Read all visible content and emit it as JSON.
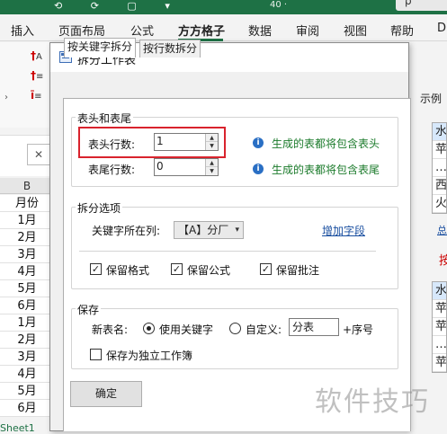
{
  "excel": {
    "title_text": "40 ·",
    "search_label": "ρ",
    "menu": [
      {
        "label": "插入"
      },
      {
        "label": "页面布局"
      },
      {
        "label": "公式"
      },
      {
        "label": "方方格子"
      },
      {
        "label": "数据"
      },
      {
        "label": "审阅"
      },
      {
        "label": "视图"
      },
      {
        "label": "帮助"
      },
      {
        "label": "D"
      }
    ],
    "column_header": "B",
    "cells": [
      "月份",
      "1月",
      "2月",
      "3月",
      "4月",
      "5月",
      "6月",
      "1月",
      "2月",
      "3月",
      "4月",
      "5月",
      "6月"
    ],
    "sheet_tab": "Sheet1",
    "formula_cancel": "✕"
  },
  "dialog": {
    "title": "拆分工作表",
    "tabs": [
      {
        "label": "按关键字拆分",
        "active": true
      },
      {
        "label": "按行数拆分",
        "active": false
      }
    ],
    "header_footer": {
      "group_label": "表头和表尾",
      "header_rows_label": "表头行数:",
      "header_rows_value": "1",
      "footer_rows_label": "表尾行数:",
      "footer_rows_value": "0",
      "header_hint": "生成的表都将包含表头",
      "footer_hint": "生成的表都将包含表尾"
    },
    "split_options": {
      "group_label": "拆分选项",
      "key_column_label": "关键字所在列:",
      "key_column_value": "【A】分厂",
      "add_field_link": "增加字段",
      "checkboxes": [
        {
          "label": "保留格式",
          "checked": true
        },
        {
          "label": "保留公式",
          "checked": true
        },
        {
          "label": "保留批注",
          "checked": true
        }
      ]
    },
    "save": {
      "group_label": "保存",
      "new_name_label": "新表名:",
      "radio_keyword_label": "使用关键字",
      "radio_custom_label": "自定义:",
      "custom_value": "分表",
      "suffix_label": "+序号",
      "independent_label": "保存为独立工作簿",
      "independent_checked": false
    },
    "ok_label": "确定"
  },
  "example": {
    "label": "示例",
    "list1": [
      "水",
      "苹",
      "…",
      "西",
      "火"
    ],
    "link": "总",
    "red_text": "按",
    "list2": [
      "水",
      "苹",
      "苹",
      "…",
      "苹"
    ]
  },
  "watermark": "软件技巧",
  "colors": {
    "excel_green": "#1e7145",
    "hint_green": "#1a7a2a",
    "highlight_red": "#d9232d",
    "link_blue": "#1a4fa0"
  }
}
